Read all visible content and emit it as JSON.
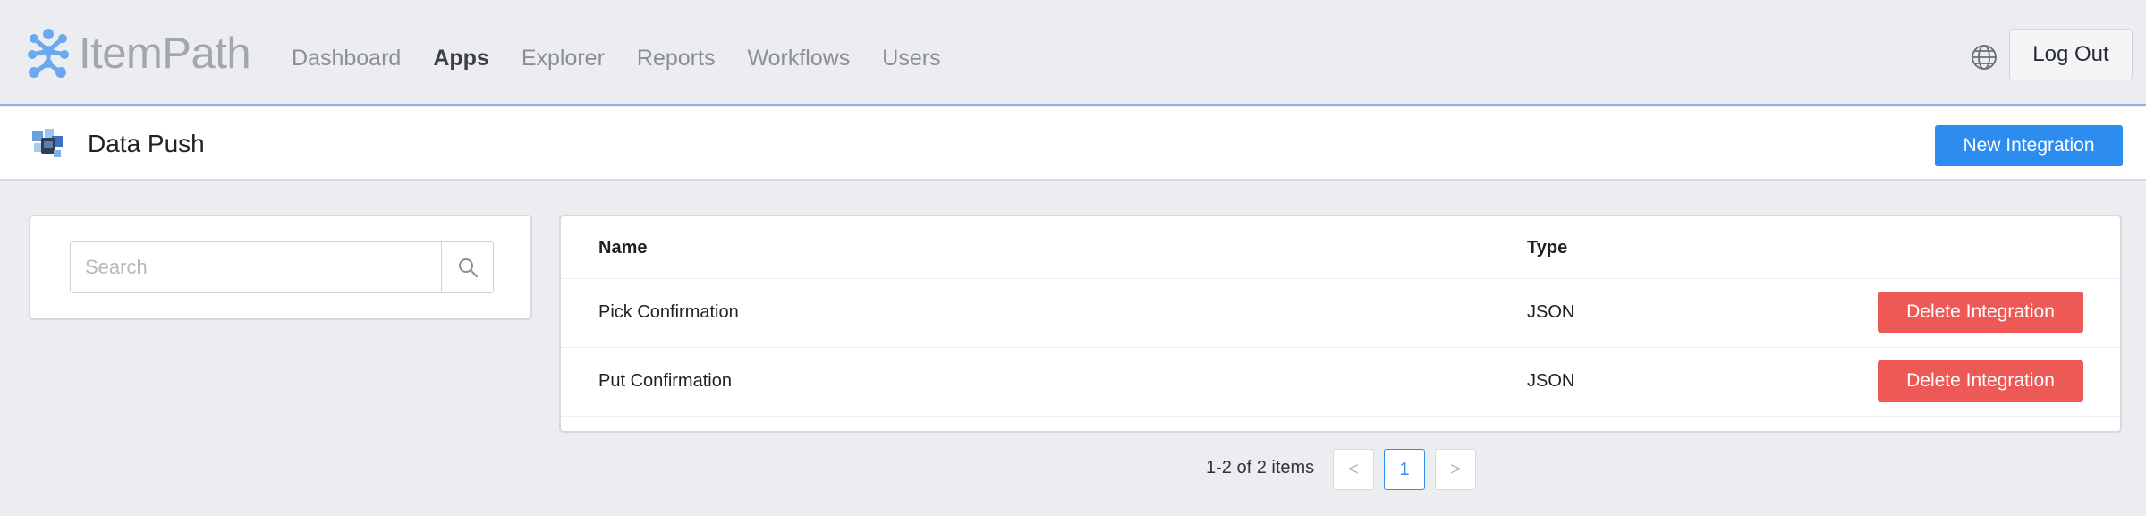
{
  "brand": {
    "name": "ItemPath",
    "accent": "#2d8cf0"
  },
  "nav": {
    "items": [
      {
        "label": "Dashboard"
      },
      {
        "label": "Apps"
      },
      {
        "label": "Explorer"
      },
      {
        "label": "Reports"
      },
      {
        "label": "Workflows"
      },
      {
        "label": "Users"
      }
    ],
    "active": "Apps",
    "language_icon": "globe-icon",
    "logout_label": "Log Out"
  },
  "page": {
    "title": "Data Push",
    "app_icon": "data-push-app-icon",
    "new_button_label": "New Integration"
  },
  "search": {
    "placeholder": "Search",
    "value": "",
    "icon": "search-icon"
  },
  "table": {
    "columns": [
      "Name",
      "Type"
    ],
    "rows": [
      {
        "name": "Pick Confirmation",
        "type": "JSON",
        "action_label": "Delete Integration"
      },
      {
        "name": "Put Confirmation",
        "type": "JSON",
        "action_label": "Delete Integration"
      }
    ],
    "delete_color": "#ed5a56"
  },
  "pagination": {
    "summary": "1-2 of 2 items",
    "prev": "<",
    "current_page": "1",
    "next": ">"
  }
}
